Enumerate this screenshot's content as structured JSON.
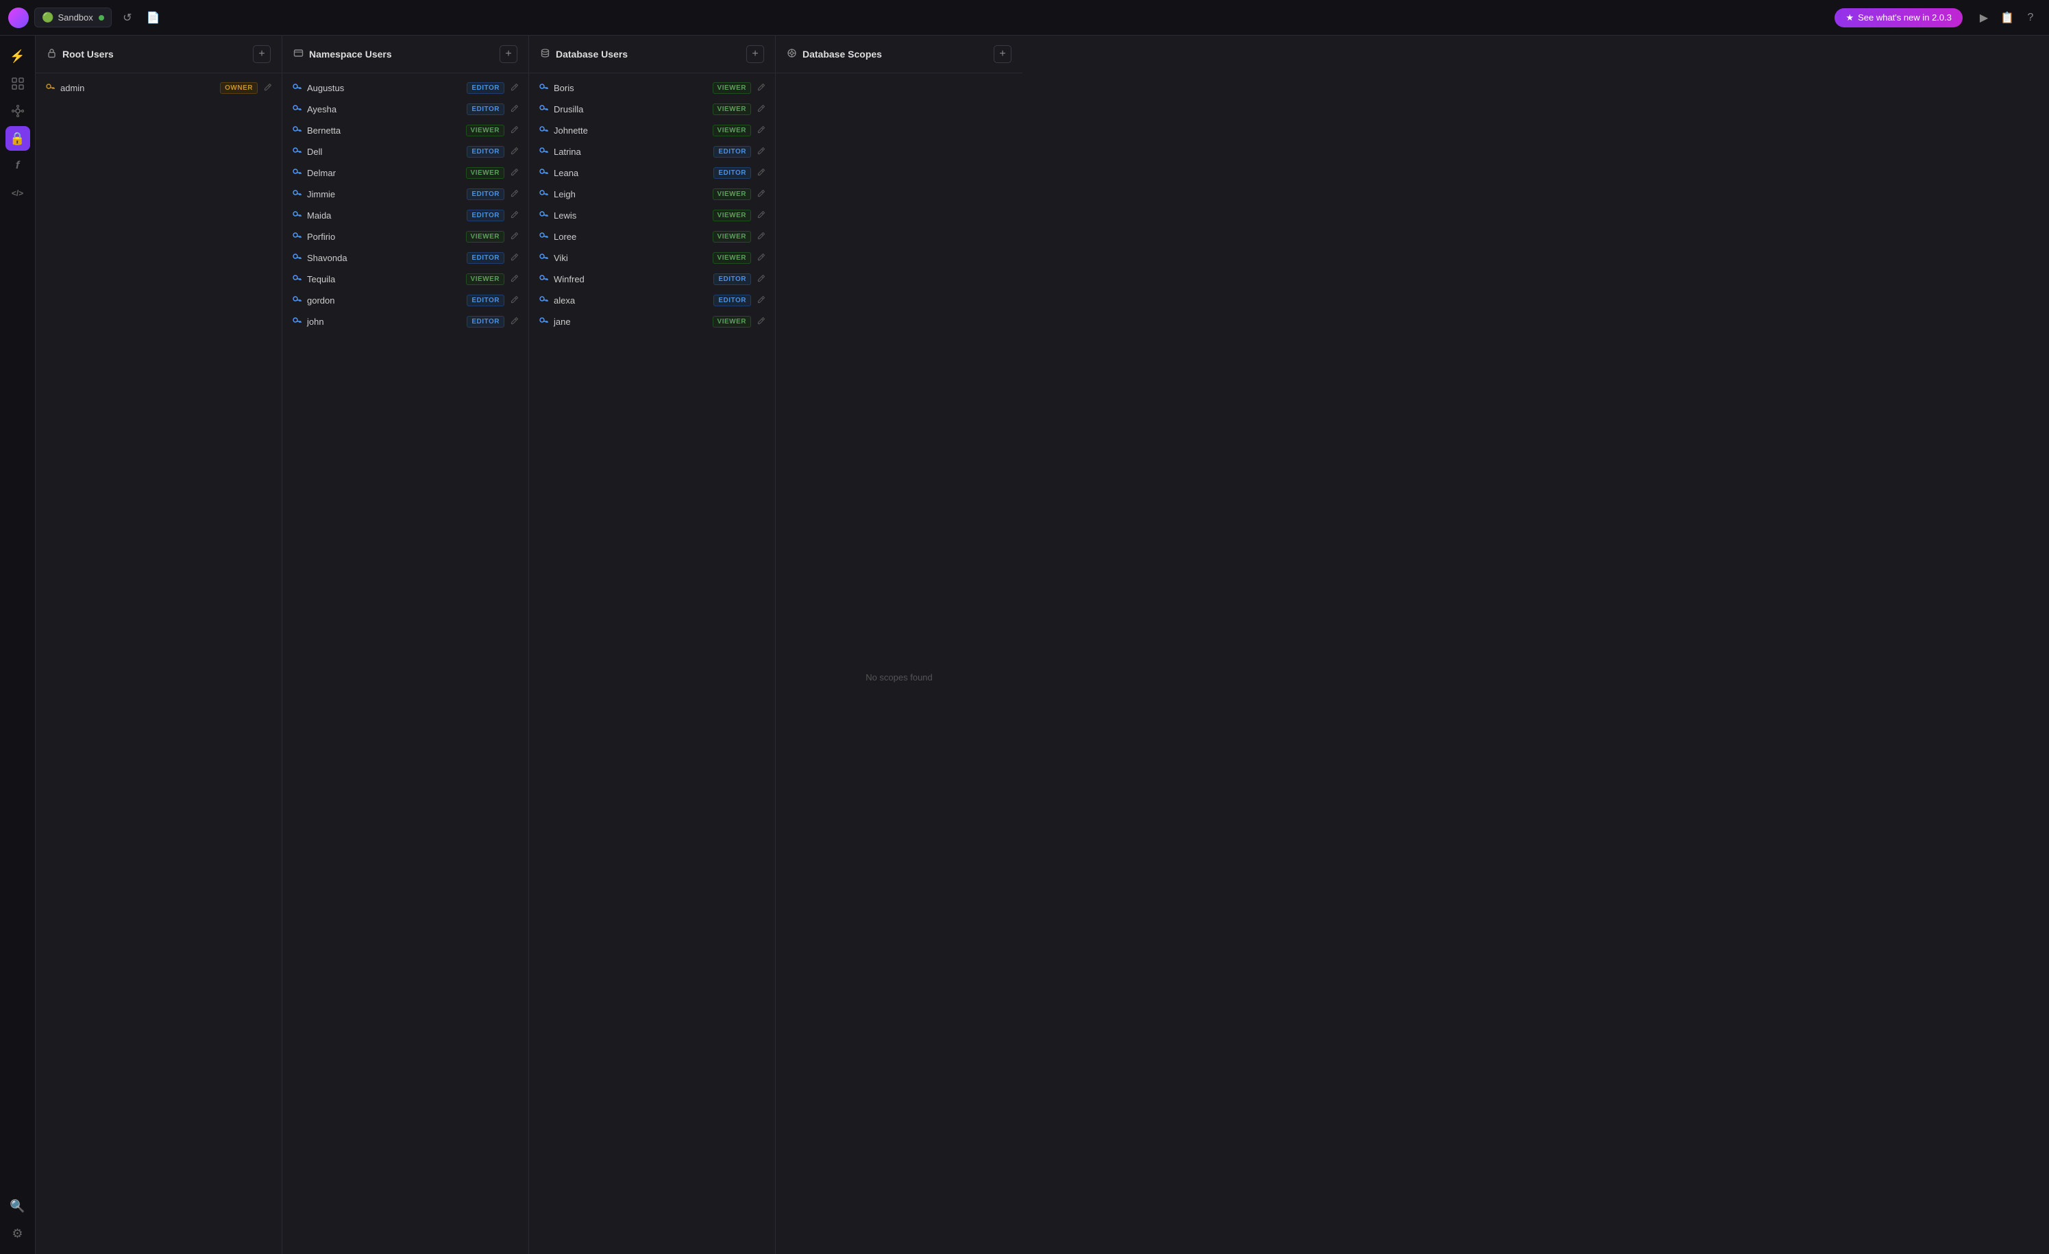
{
  "topbar": {
    "avatar_alt": "user-avatar",
    "sandbox_label": "Sandbox",
    "sandbox_status": "active",
    "undo_icon": "↺",
    "file_icon": "📄",
    "new_badge_label": "See what's new in 2.0.3",
    "star_icon": "★",
    "play_icon": "▶",
    "doc_icon": "📋",
    "help_icon": "?"
  },
  "sidebar": {
    "items": [
      {
        "id": "home",
        "icon": "⚡",
        "active": false,
        "label": "home-icon"
      },
      {
        "id": "grid",
        "icon": "⊞",
        "active": false,
        "label": "grid-icon"
      },
      {
        "id": "nodes",
        "icon": "⬡",
        "active": false,
        "label": "nodes-icon"
      },
      {
        "id": "lock",
        "icon": "🔒",
        "active": true,
        "label": "lock-icon"
      },
      {
        "id": "function",
        "icon": "ƒ",
        "active": false,
        "label": "function-icon"
      },
      {
        "id": "code",
        "icon": "</>",
        "active": false,
        "label": "code-icon"
      }
    ],
    "bottom_items": [
      {
        "id": "search",
        "icon": "🔍",
        "label": "search-icon"
      },
      {
        "id": "settings",
        "icon": "⚙",
        "label": "settings-icon"
      }
    ]
  },
  "panels": [
    {
      "id": "root-users",
      "title": "Root Users",
      "header_icon": "lock",
      "users": [
        {
          "name": "admin",
          "role": "OWNER"
        }
      ],
      "empty_text": ""
    },
    {
      "id": "namespace-users",
      "title": "Namespace Users",
      "header_icon": "namespace",
      "users": [
        {
          "name": "Augustus",
          "role": "EDITOR"
        },
        {
          "name": "Ayesha",
          "role": "EDITOR"
        },
        {
          "name": "Bernetta",
          "role": "VIEWER"
        },
        {
          "name": "Dell",
          "role": "EDITOR"
        },
        {
          "name": "Delmar",
          "role": "VIEWER"
        },
        {
          "name": "Jimmie",
          "role": "EDITOR"
        },
        {
          "name": "Maida",
          "role": "EDITOR"
        },
        {
          "name": "Porfirio",
          "role": "VIEWER"
        },
        {
          "name": "Shavonda",
          "role": "EDITOR"
        },
        {
          "name": "Tequila",
          "role": "VIEWER"
        },
        {
          "name": "gordon",
          "role": "EDITOR"
        },
        {
          "name": "john",
          "role": "EDITOR"
        }
      ],
      "empty_text": ""
    },
    {
      "id": "database-users",
      "title": "Database Users",
      "header_icon": "database",
      "users": [
        {
          "name": "Boris",
          "role": "VIEWER"
        },
        {
          "name": "Drusilla",
          "role": "VIEWER"
        },
        {
          "name": "Johnette",
          "role": "VIEWER"
        },
        {
          "name": "Latrina",
          "role": "EDITOR"
        },
        {
          "name": "Leana",
          "role": "EDITOR"
        },
        {
          "name": "Leigh",
          "role": "VIEWER"
        },
        {
          "name": "Lewis",
          "role": "VIEWER"
        },
        {
          "name": "Loree",
          "role": "VIEWER"
        },
        {
          "name": "Viki",
          "role": "VIEWER"
        },
        {
          "name": "Winfred",
          "role": "EDITOR"
        },
        {
          "name": "alexa",
          "role": "EDITOR"
        },
        {
          "name": "jane",
          "role": "VIEWER"
        }
      ],
      "empty_text": ""
    },
    {
      "id": "database-scopes",
      "title": "Database Scopes",
      "header_icon": "scopes",
      "users": [],
      "empty_text": "No scopes found"
    }
  ],
  "labels": {
    "no_scopes": "No scopes found",
    "edit_pencil": "✏"
  }
}
